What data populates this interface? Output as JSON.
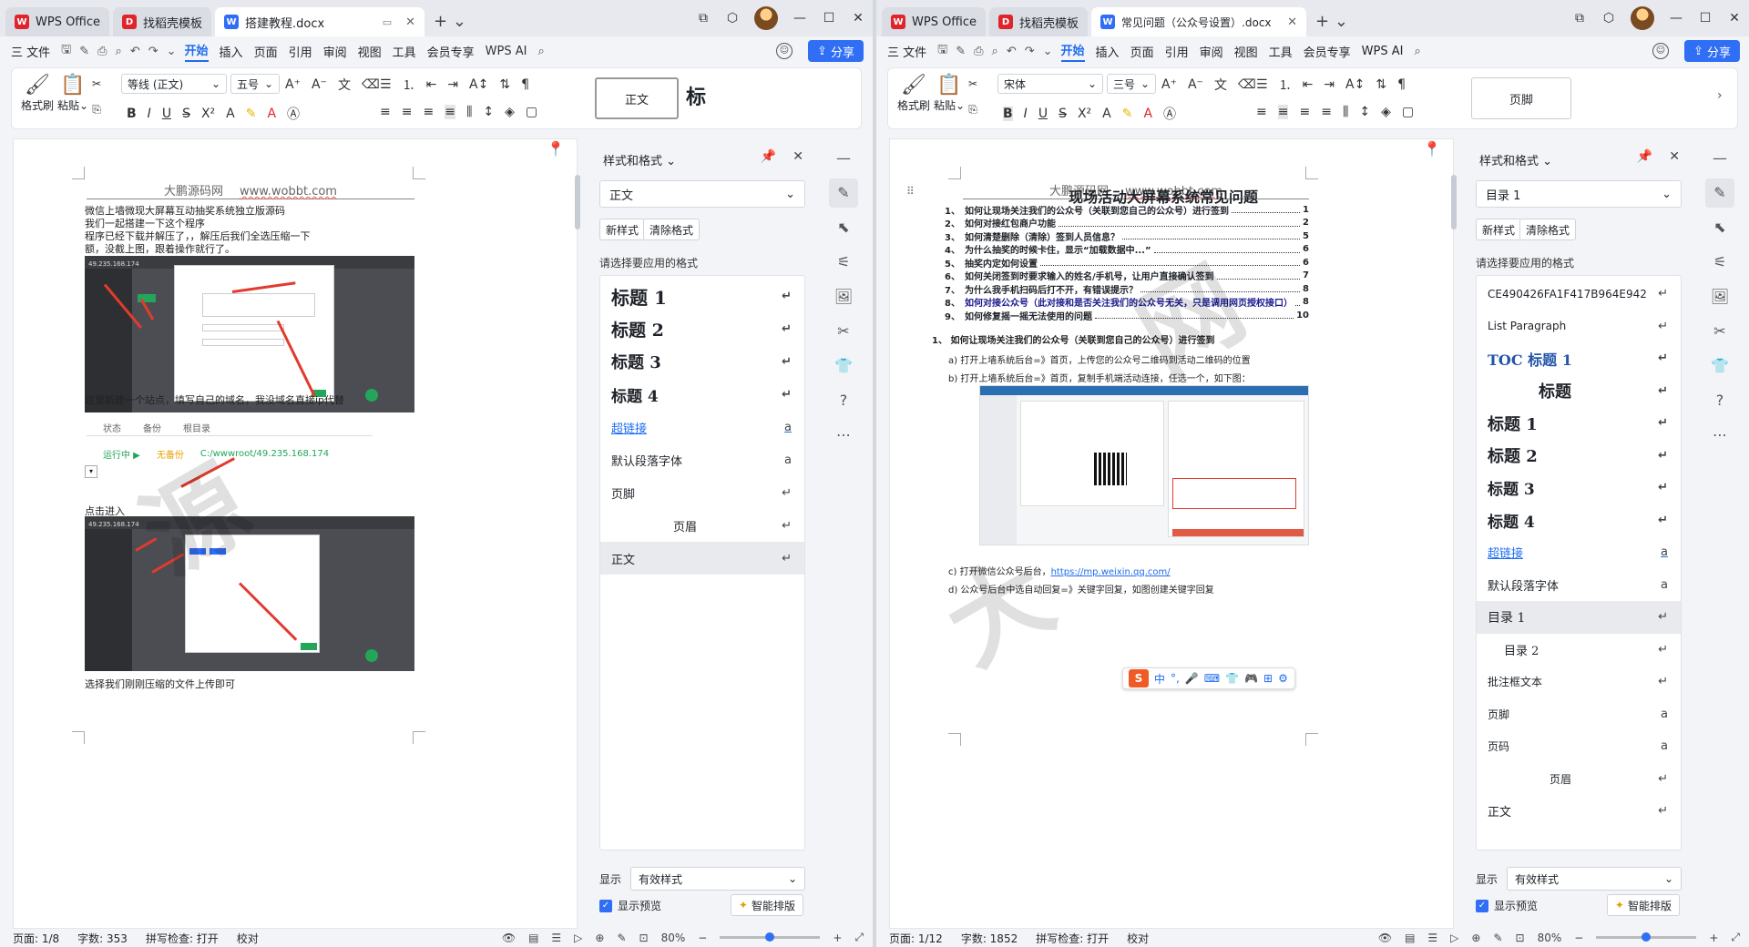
{
  "left": {
    "tabs": [
      {
        "label": "WPS Office",
        "icon": "wps-logo-icon",
        "color": "#e0242b"
      },
      {
        "label": "找稻壳模板",
        "icon": "docer-icon",
        "color": "#e0242b"
      },
      {
        "label": "搭建教程.docx",
        "icon": "word-doc-icon",
        "color": "#2f6ef5"
      }
    ],
    "menu": [
      "三 文件",
      "开始",
      "插入",
      "页面",
      "引用",
      "审阅",
      "视图",
      "工具",
      "会员专享",
      "WPS AI"
    ],
    "share": "分享",
    "ribbon": {
      "format_painter": "格式刷",
      "paste": "粘贴",
      "font": "等线 (正文)",
      "size": "五号",
      "style_preview_1": "正文",
      "style_preview_2": "标"
    },
    "doc": {
      "header_site": "大鹏源码网",
      "header_url": "www.wobbt.com",
      "lines": [
        "微信上墙微现大屏幕互动抽奖系统独立版源码",
        "我们一起搭建一下这个程序",
        "程序已经下载并解压了，，解压后我们全选压缩一下",
        "额，没截上图，跟着操作就行了。"
      ],
      "caption_1": "这里新建一个站点，填写自己的域名，我没域名直接ip代替",
      "table": {
        "headers": [
          "状态",
          "备份",
          "根目录"
        ],
        "row": [
          "运行中 ▶",
          "无备份",
          "C:/wwwroot/49.235.168.174"
        ]
      },
      "caption_2": "点击进入",
      "caption_3": "选择我们刚刚压缩的文件上传即可",
      "shot1_addr": "49.235.168.174",
      "shot2_addr": "49.235.168.174"
    },
    "pane": {
      "title": "样式和格式",
      "current": "正文",
      "new_style": "新样式",
      "clear": "清除格式",
      "hint": "请选择要应用的格式",
      "items": [
        {
          "label": "标题  1",
          "mark": "↵"
        },
        {
          "label": "标题  2",
          "mark": "↵"
        },
        {
          "label": "标题  3",
          "mark": "↵"
        },
        {
          "label": "标题  4",
          "mark": "↵"
        },
        {
          "label": "超链接",
          "mark": "a"
        },
        {
          "label": "默认段落字体",
          "mark": "a"
        },
        {
          "label": "页脚",
          "mark": "↵"
        },
        {
          "label": "页眉",
          "mark": "↵"
        },
        {
          "label": "正文",
          "mark": "↵"
        }
      ],
      "show_label": "显示",
      "show_value": "有效样式",
      "preview": "显示预览",
      "smart": "智能排版"
    },
    "status": {
      "page": "页面: 1/8",
      "words": "字数: 353",
      "spell": "拼写检查: 打开",
      "proof": "校对",
      "zoom": "80%"
    }
  },
  "right": {
    "tabs": [
      {
        "label": "WPS Office",
        "icon": "wps-logo-icon",
        "color": "#e0242b"
      },
      {
        "label": "找稻壳模板",
        "icon": "docer-icon",
        "color": "#e0242b"
      },
      {
        "label": "常见问题（公众号设置）.docx",
        "icon": "word-doc-icon",
        "color": "#2f6ef5"
      }
    ],
    "menu": [
      "三 文件",
      "开始",
      "插入",
      "页面",
      "引用",
      "审阅",
      "视图",
      "工具",
      "会员专享",
      "WPS AI"
    ],
    "share": "分享",
    "ribbon": {
      "format_painter": "格式刷",
      "paste": "粘贴",
      "font": "宋体",
      "size": "三号",
      "style_preview_1": "页脚"
    },
    "doc": {
      "header_site": "大鹏源码网",
      "header_url": "www.wobbt.com",
      "title": "现场活动大屏幕系统常见问题",
      "toc": [
        {
          "n": "1、",
          "t": "如何让现场关注我们的公众号（关联到您自己的公众号）进行签到",
          "p": "1"
        },
        {
          "n": "2、",
          "t": "如何对接红包商户功能",
          "p": "2"
        },
        {
          "n": "3、",
          "t": "如何清楚删除（清除）签到人员信息？",
          "p": "5"
        },
        {
          "n": "4、",
          "t": "为什么抽奖的时候卡住，显示“加载数据中...”",
          "p": "6"
        },
        {
          "n": "5、",
          "t": "抽奖内定如何设置",
          "p": "6"
        },
        {
          "n": "6、",
          "t": "如何关闭签到时要求输入的姓名/手机号，让用户直接确认签到",
          "p": "7"
        },
        {
          "n": "7、",
          "t": "为什么我手机扫码后打不开，有错误提示？",
          "p": "8"
        },
        {
          "n": "8、",
          "t": "如何对接公众号（此对接和是否关注我们的公众号无关，只是调用网页授权接口）",
          "p": "8"
        },
        {
          "n": "9、",
          "t": "如何修复摇一摇无法使用的问题",
          "p": "10"
        }
      ],
      "section_1": "1、 如何让现场关注我们的公众号（关联到您自己的公众号）进行签到",
      "step_a": "a)   打开上墙系统后台=》首页，上传您的公众号二维码到活动二维码的位置",
      "step_b": "b)   打开上墙系统后台=》首页，复制手机端活动连接，任选一个，如下图：",
      "step_c_prefix": "c)   打开微信公众号后台，",
      "step_c_link": "https://mp.weixin.qq.com/",
      "step_d": "d)   公众号后台中选自动回复=》关键字回复，如图创建关键字回复",
      "ime": [
        "中",
        "°,",
        "🎤",
        "⌨",
        "👕",
        "🎮",
        "⊞",
        "⚙"
      ]
    },
    "pane": {
      "title": "样式和格式",
      "current": "目录  1",
      "new_style": "新样式",
      "clear": "清除格式",
      "hint": "请选择要应用的格式",
      "items": [
        {
          "label": "CE490426FA1F417B964E942",
          "mark": "↵"
        },
        {
          "label": "List Paragraph",
          "mark": "↵"
        },
        {
          "label": "TOC  标题 1",
          "mark": "↵"
        },
        {
          "label": "标题",
          "mark": "↵"
        },
        {
          "label": "标题  1",
          "mark": "↵"
        },
        {
          "label": "标题  2",
          "mark": "↵"
        },
        {
          "label": "标题  3",
          "mark": "↵"
        },
        {
          "label": "标题  4",
          "mark": "↵"
        },
        {
          "label": "超链接",
          "mark": "a"
        },
        {
          "label": "默认段落字体",
          "mark": "a"
        },
        {
          "label": "目录  1",
          "mark": "↵"
        },
        {
          "label": "目录  2",
          "mark": "↵"
        },
        {
          "label": "批注框文本",
          "mark": "↵"
        },
        {
          "label": "页脚",
          "mark": "a"
        },
        {
          "label": "页码",
          "mark": "a"
        },
        {
          "label": "页眉",
          "mark": "↵"
        },
        {
          "label": "正文",
          "mark": "↵"
        }
      ],
      "show_label": "显示",
      "show_value": "有效样式",
      "preview": "显示预览",
      "smart": "智能排版"
    },
    "status": {
      "page": "页面: 1/12",
      "words": "字数: 1852",
      "spell": "拼写检查: 打开",
      "proof": "校对",
      "zoom": "80%"
    }
  },
  "colors": {
    "accent": "#2f6ef5",
    "wps_red": "#e0242b",
    "arrow_red": "#e23b2e",
    "green": "#23a55a"
  }
}
